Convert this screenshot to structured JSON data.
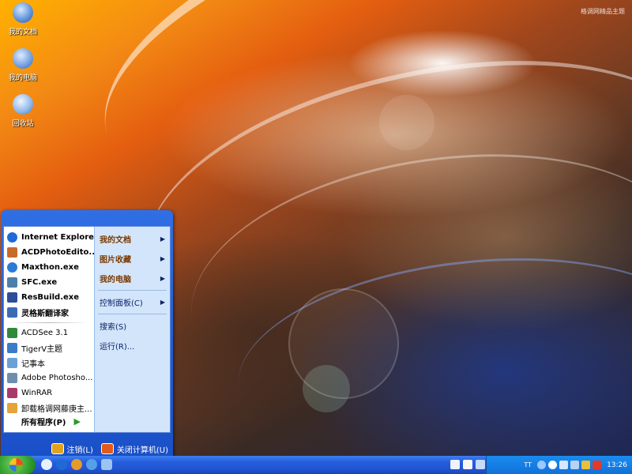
{
  "desktop": {
    "watermark": "格调网精品主题",
    "icons": [
      {
        "label": "我的文档",
        "icon": "my-documents-icon"
      },
      {
        "label": "我的电脑",
        "icon": "my-computer-icon"
      },
      {
        "label": "回收站",
        "icon": "recycle-bin-icon"
      }
    ]
  },
  "start_menu": {
    "pinned": [
      {
        "label": "Internet Explorer",
        "icon": "ie-icon",
        "color": "#1e6ad8"
      },
      {
        "label": "ACDPhotoEdito...",
        "icon": "acd-photo-editor-icon",
        "color": "#c86a2a"
      },
      {
        "label": "Maxthon.exe",
        "icon": "maxthon-icon",
        "color": "#2a7bd6"
      },
      {
        "label": "SFC.exe",
        "icon": "sfc-icon",
        "color": "#4f7fa8"
      },
      {
        "label": "ResBuild.exe",
        "icon": "resbuild-icon",
        "color": "#2b4d9a"
      },
      {
        "label": "灵格斯翻译家",
        "icon": "lingoes-icon",
        "color": "#3a6bb5"
      }
    ],
    "recent": [
      {
        "label": "ACDSee 3.1",
        "icon": "acdsee-icon",
        "color": "#2f8a3a"
      },
      {
        "label": "TigerV主题",
        "icon": "tigerv-icon",
        "color": "#3b7bc8"
      },
      {
        "label": "记事本",
        "icon": "notepad-icon",
        "color": "#6aa0d8"
      },
      {
        "label": "Adobe Photosho...",
        "icon": "photoshop-icon",
        "color": "#6c8fae"
      },
      {
        "label": "WinRAR",
        "icon": "winrar-icon",
        "color": "#a83a6a"
      },
      {
        "label": "卸载格调网藤庚主...",
        "icon": "uninstall-icon",
        "color": "#e3a43a"
      }
    ],
    "all_programs": "所有程序(P)",
    "places": [
      {
        "label": "我的文档",
        "bold": true,
        "submenu": true
      },
      {
        "label": "图片收藏",
        "bold": true,
        "submenu": true
      },
      {
        "label": "我的电脑",
        "bold": true,
        "submenu": true
      },
      {
        "label": "控制面板(C)",
        "bold": false,
        "submenu": true
      },
      {
        "label": "搜索(S)",
        "bold": false,
        "submenu": false
      },
      {
        "label": "运行(R)...",
        "bold": false,
        "submenu": false
      }
    ],
    "logoff": "注销(L)",
    "shutdown": "关闭计算机(U)"
  },
  "taskbar": {
    "clock": "13:26",
    "tray_label": "TT"
  }
}
